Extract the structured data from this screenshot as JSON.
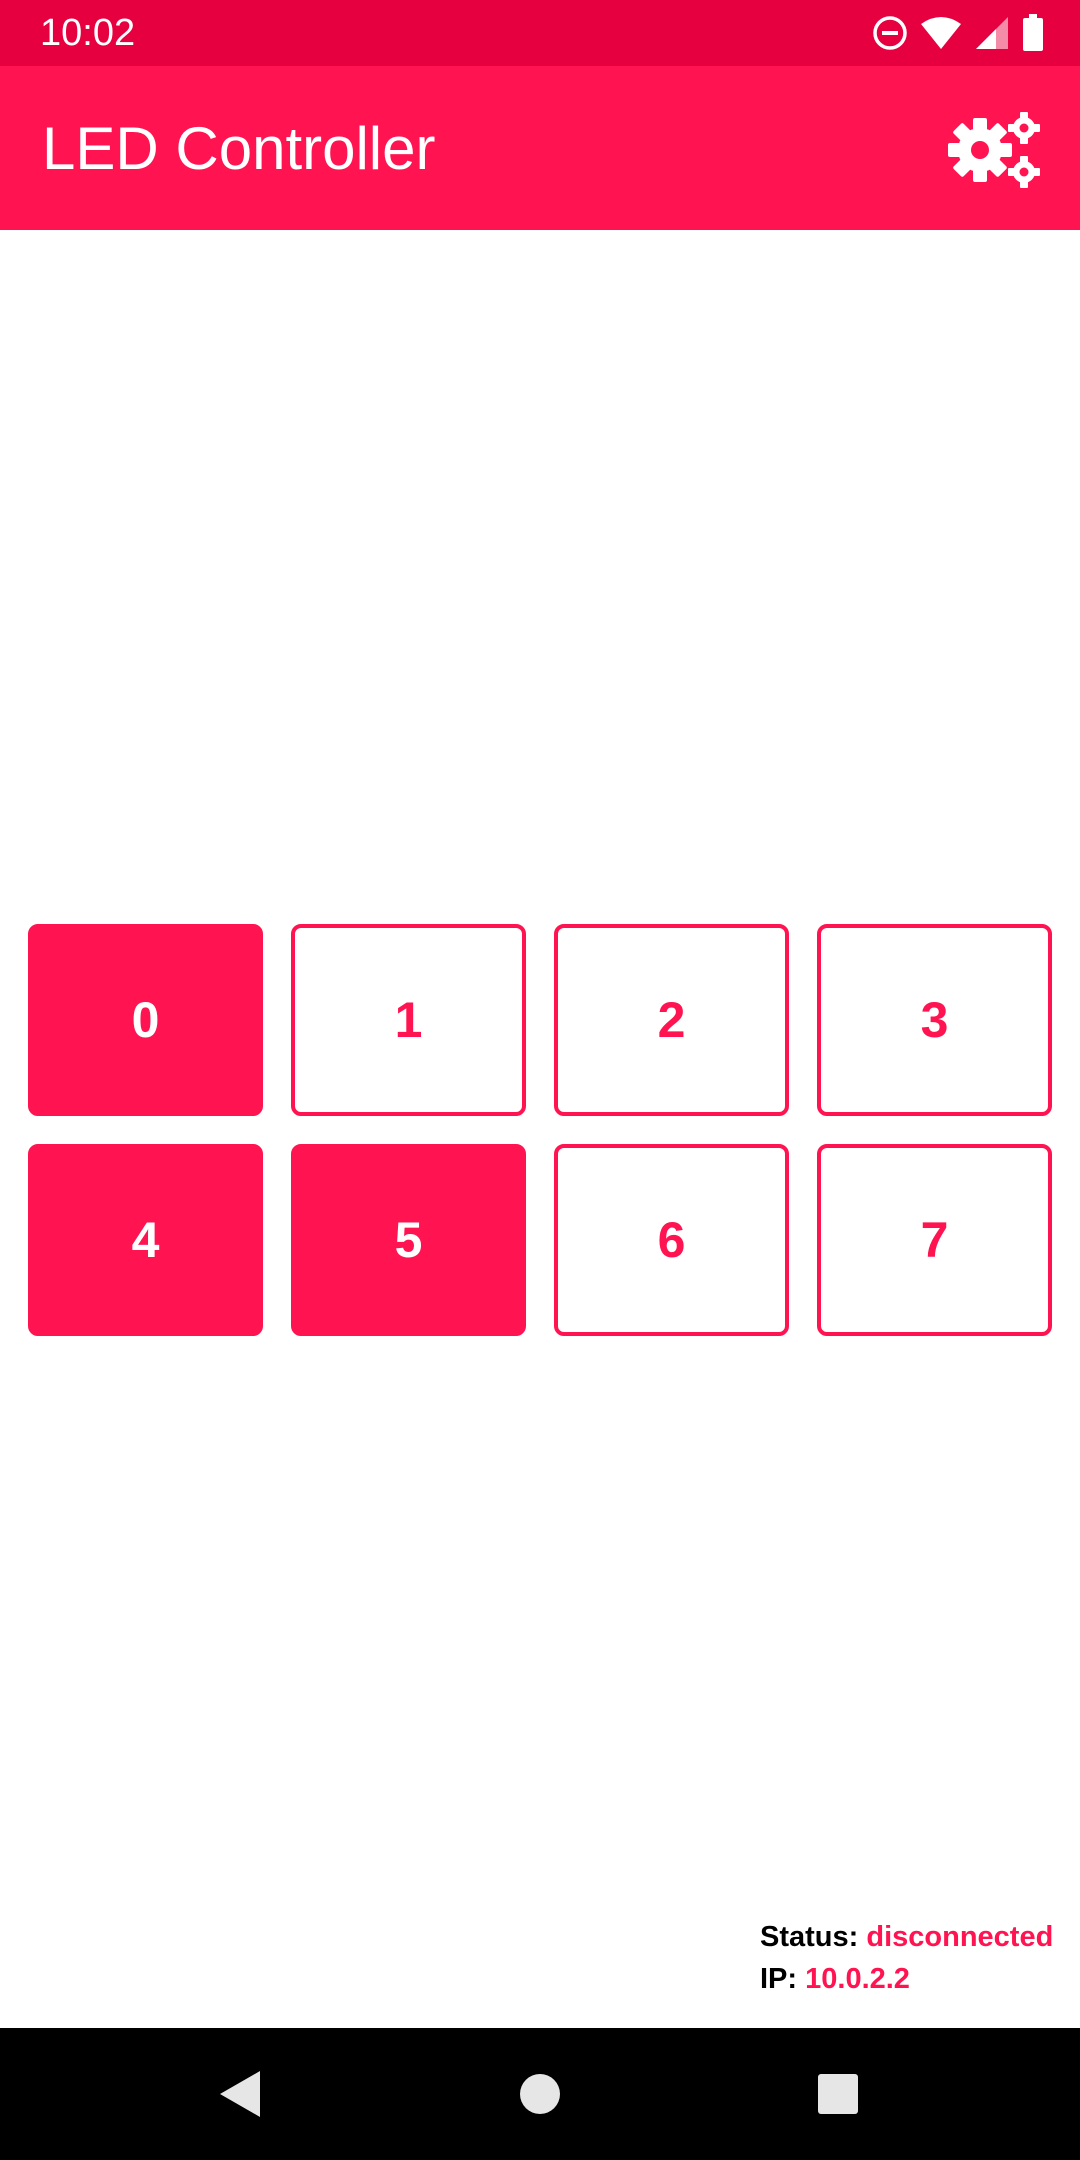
{
  "status_bar": {
    "time": "10:02",
    "icons": [
      "do-not-disturb-icon",
      "wifi-icon",
      "signal-icon",
      "battery-icon"
    ]
  },
  "app_bar": {
    "title": "LED Controller",
    "settings_icon": "settings-gears-icon"
  },
  "leds": [
    {
      "label": "0",
      "on": true
    },
    {
      "label": "1",
      "on": false
    },
    {
      "label": "2",
      "on": false
    },
    {
      "label": "3",
      "on": false
    },
    {
      "label": "4",
      "on": true
    },
    {
      "label": "5",
      "on": true
    },
    {
      "label": "6",
      "on": false
    },
    {
      "label": "7",
      "on": false
    }
  ],
  "info": {
    "status_label": "Status:",
    "status_value": "disconnected",
    "ip_label": "IP:",
    "ip_value": "10.0.2.2"
  },
  "colors": {
    "accent": "#FF1451",
    "status_bar": "#E60040",
    "nav_bar": "#000000"
  },
  "nav_bar": {
    "buttons": [
      "back-icon",
      "home-icon",
      "recents-icon"
    ]
  }
}
